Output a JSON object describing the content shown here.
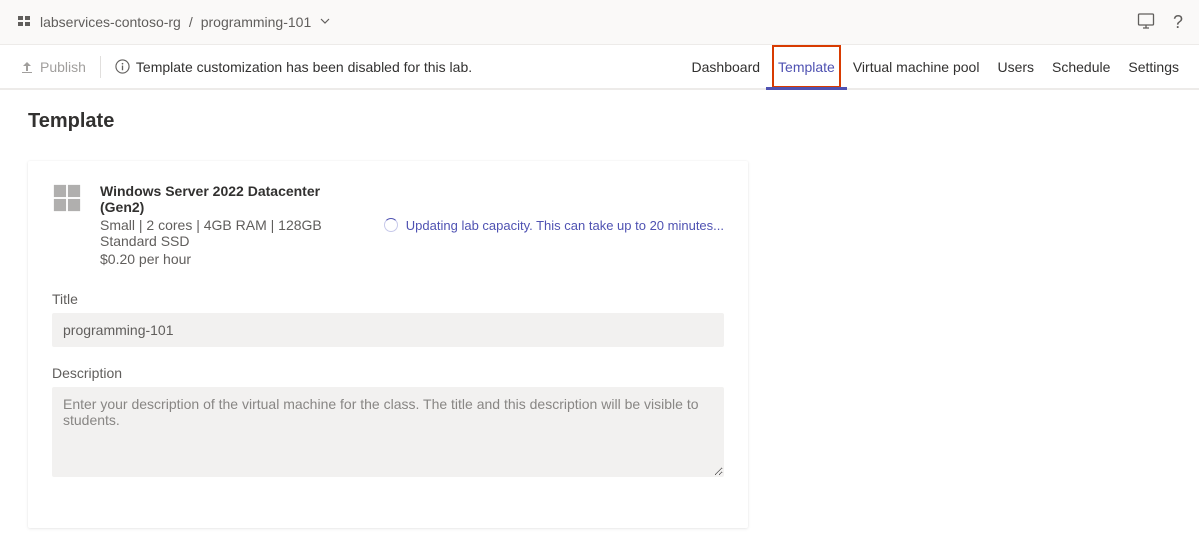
{
  "breadcrumb": {
    "parent": "labservices-contoso-rg",
    "separator": "/",
    "current": "programming-101"
  },
  "command_bar": {
    "publish_label": "Publish",
    "info_message": "Template customization has been disabled for this lab."
  },
  "tabs": {
    "dashboard": "Dashboard",
    "template": "Template",
    "vm_pool": "Virtual machine pool",
    "users": "Users",
    "schedule": "Schedule",
    "settings": "Settings"
  },
  "page": {
    "title": "Template"
  },
  "vm": {
    "name": "Windows Server 2022 Datacenter (Gen2)",
    "spec": "Small | 2 cores | 4GB RAM | 128GB Standard SSD",
    "cost": "$0.20 per hour"
  },
  "status": {
    "updating": "Updating lab capacity. This can take up to 20 minutes..."
  },
  "form": {
    "title_label": "Title",
    "title_value": "programming-101",
    "description_label": "Description",
    "description_placeholder": "Enter your description of the virtual machine for the class. The title and this description will be visible to students."
  }
}
